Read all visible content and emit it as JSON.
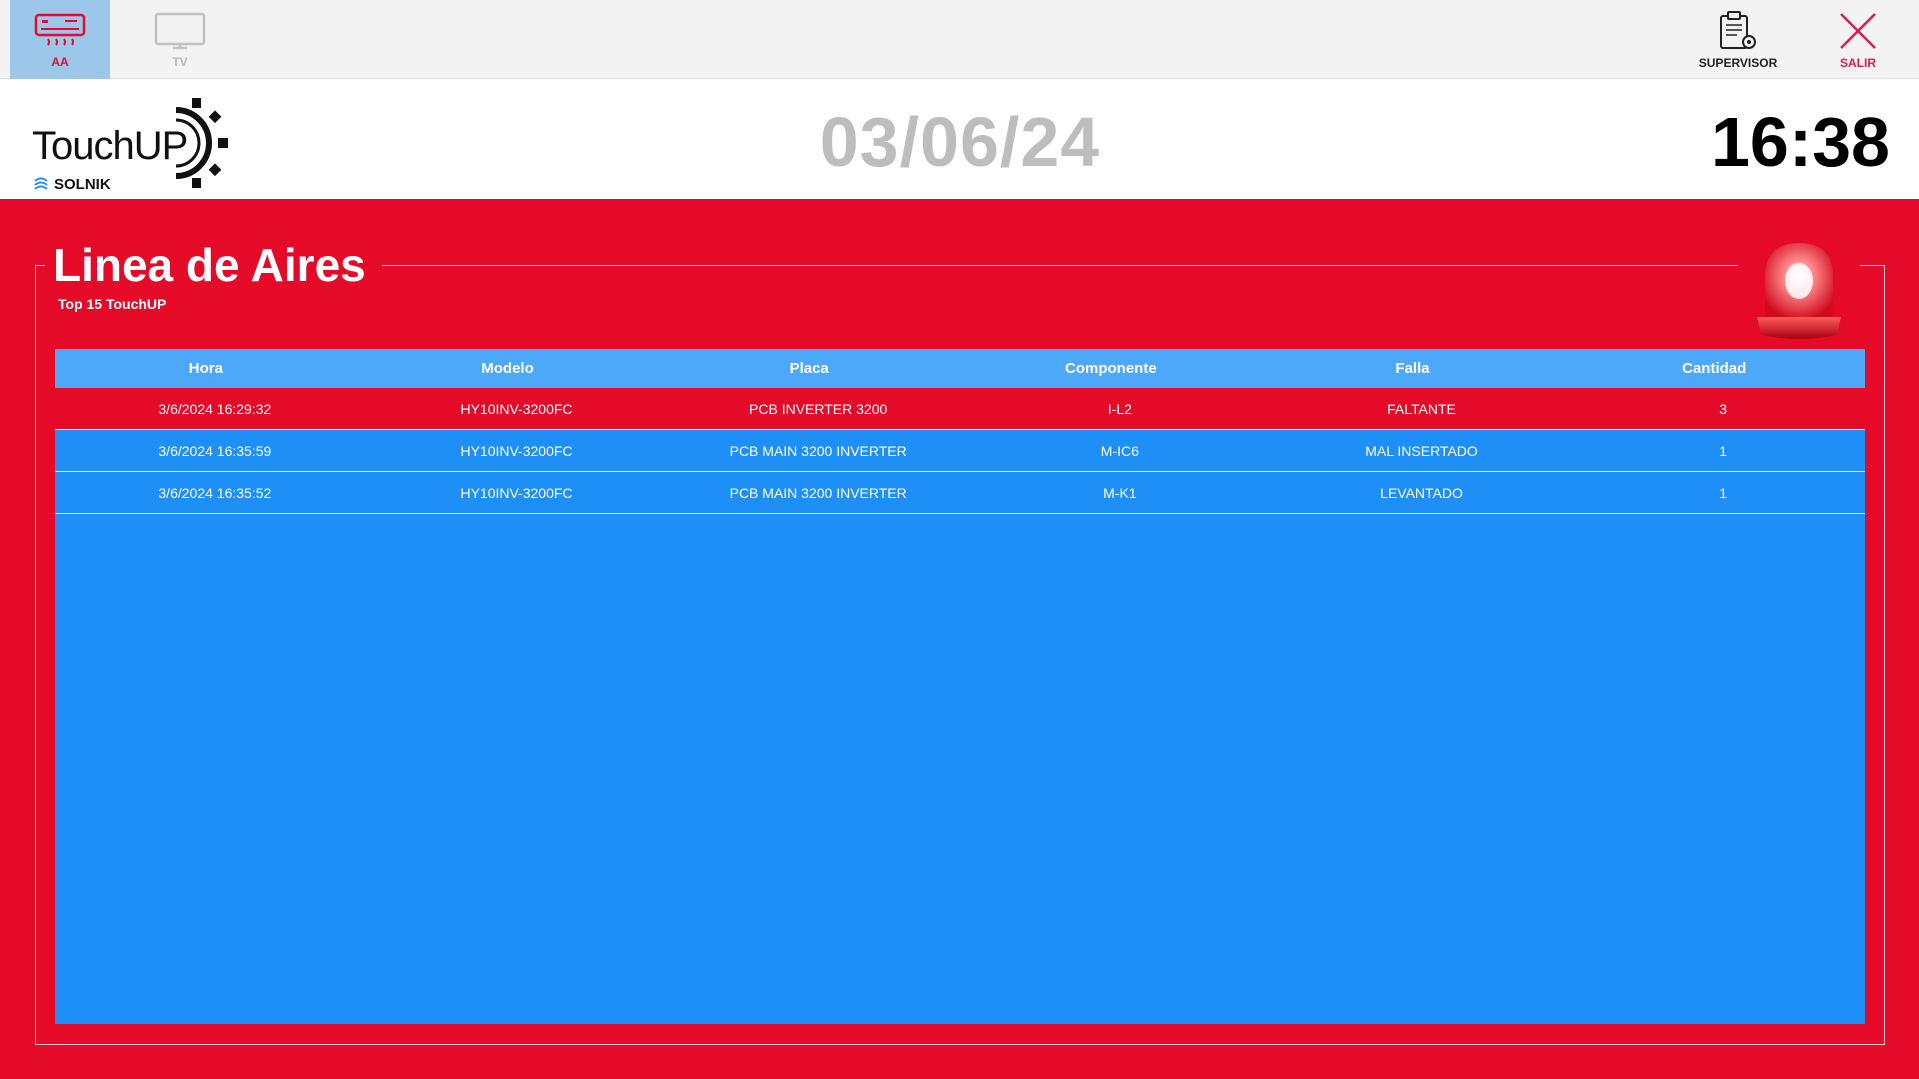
{
  "toolbar": {
    "aa_label": "AA",
    "tv_label": "TV",
    "supervisor_label": "SUPERVISOR",
    "exit_label": "SALIR"
  },
  "header": {
    "logo_text": "TouchUP",
    "logo_sub": "SOLNIK",
    "date": "03/06/24",
    "time": "16:38"
  },
  "panel": {
    "title": "Linea de Aires",
    "subtitle": "Top 15 TouchUP"
  },
  "table": {
    "columns": [
      "Hora",
      "Modelo",
      "Placa",
      "Componente",
      "Falla",
      "Cantidad"
    ],
    "rows": [
      [
        "3/6/2024 16:29:32",
        "HY10INV-3200FC",
        "PCB INVERTER 3200",
        "I-L2",
        "FALTANTE",
        "3"
      ],
      [
        "3/6/2024 16:35:59",
        "HY10INV-3200FC",
        "PCB MAIN 3200 INVERTER",
        "M-IC6",
        "MAL INSERTADO",
        "1"
      ],
      [
        "3/6/2024 16:35:52",
        "HY10INV-3200FC",
        "PCB MAIN 3200 INVERTER",
        "M-K1",
        "LEVANTADO",
        "1"
      ]
    ]
  },
  "colors": {
    "panel_red": "#e50b28",
    "table_blue": "#1e8ff7",
    "header_blue": "#4ea8fa",
    "date_gray": "#bdbdbd"
  },
  "icons": {
    "aa": "air-conditioner-icon",
    "tv": "tv-icon",
    "supervisor": "clipboard-gear-icon",
    "exit": "close-icon",
    "alarm": "siren-icon"
  }
}
